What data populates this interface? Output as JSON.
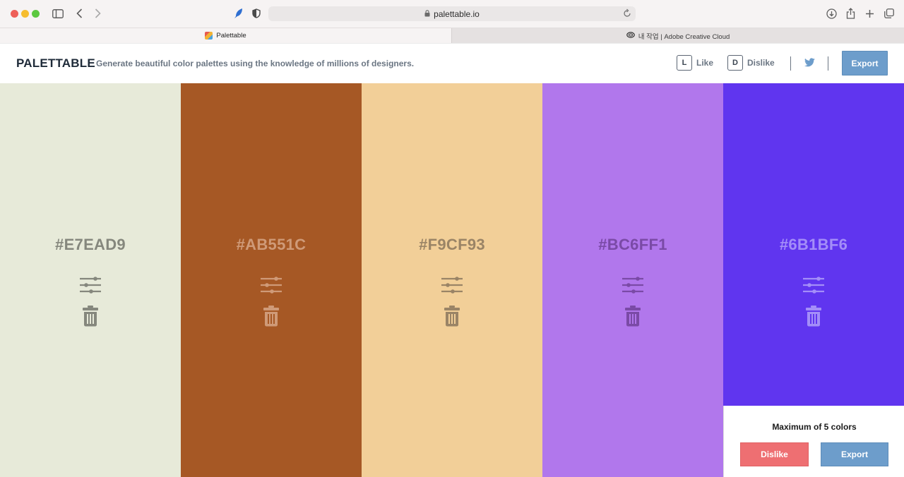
{
  "browser": {
    "url": "palettable.io",
    "tabs": [
      {
        "label": "Palettable",
        "active": true
      },
      {
        "label": "내 작업 | Adobe Creative Cloud",
        "active": false
      }
    ]
  },
  "header": {
    "brand": "PALETTABLE",
    "tagline": "Generate beautiful color palettes using the knowledge of millions of designers.",
    "like": {
      "key": "L",
      "label": "Like"
    },
    "dislike": {
      "key": "D",
      "label": "Dislike"
    },
    "export_label": "Export",
    "accent_color": "#6D9DCB"
  },
  "palette": {
    "swatches": [
      {
        "hex": "#E7EAD9",
        "bg": "#E7EAD9",
        "text_color": "#85877d"
      },
      {
        "hex": "#AB551C",
        "bg": "#A65825",
        "text_color": "#cf9a78"
      },
      {
        "hex": "#F9CF93",
        "bg": "#F2CF98",
        "text_color": "#9a8466"
      },
      {
        "hex": "#BC6FF1",
        "bg": "#B177EC",
        "text_color": "#7a4aa6"
      },
      {
        "hex": "#6B1BF6",
        "bg": "#6035EF",
        "text_color": "#a48ef8"
      }
    ]
  },
  "panel": {
    "title": "Maximum of 5 colors",
    "dislike_label": "Dislike",
    "export_label": "Export",
    "dislike_color": "#EE6F72",
    "export_color": "#6D9DCB"
  }
}
